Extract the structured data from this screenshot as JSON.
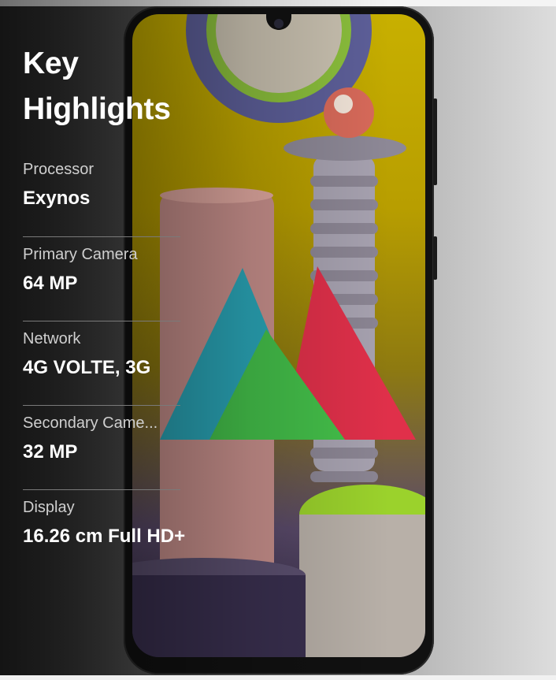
{
  "page": {
    "heading": "Key\nHighlights"
  },
  "highlights": [
    {
      "label": "Processor",
      "value": "Exynos"
    },
    {
      "label": "Primary Camera",
      "value": "64 MP"
    },
    {
      "label": "Network",
      "value": "4G VOLTE, 3G"
    },
    {
      "label": "Secondary Came...",
      "value": "32 MP"
    },
    {
      "label": "Display",
      "value": "16.26 cm Full HD+"
    }
  ],
  "colors": {
    "text": "#ffffff",
    "label": "#c9c9c9",
    "divider": "#7a7a7a",
    "screen_yellow": "#c8b000",
    "cone_teal": "#2aa6b8",
    "cone_red": "#e0304a",
    "cone_green": "#44c04a"
  },
  "icons": {
    "camera": "front-camera-icon"
  }
}
